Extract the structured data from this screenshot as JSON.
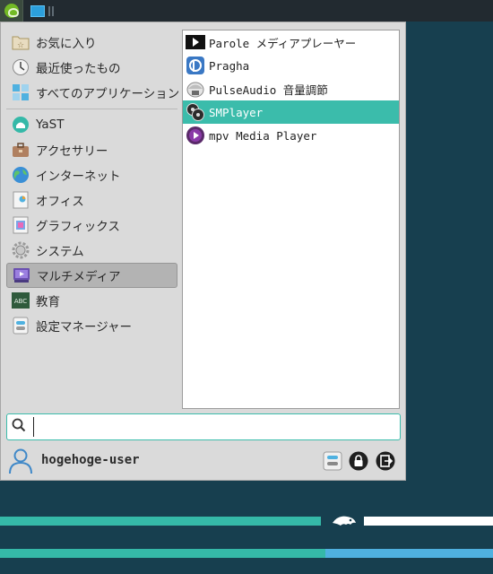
{
  "categories": [
    {
      "label": "お気に入り",
      "icon": "favorites-folder-icon"
    },
    {
      "label": "最近使ったもの",
      "icon": "recent-clock-icon"
    },
    {
      "label": "すべてのアプリケーション",
      "icon": "all-apps-grid-icon"
    },
    {
      "label": "YaST",
      "icon": "yast-icon"
    },
    {
      "label": "アクセサリー",
      "icon": "accessories-briefcase-icon"
    },
    {
      "label": "インターネット",
      "icon": "internet-globe-icon"
    },
    {
      "label": "オフィス",
      "icon": "office-icon"
    },
    {
      "label": "グラフィックス",
      "icon": "graphics-icon"
    },
    {
      "label": "システム",
      "icon": "system-gear-icon"
    },
    {
      "label": "マルチメディア",
      "icon": "multimedia-icon"
    },
    {
      "label": "教育",
      "icon": "education-abc-icon"
    },
    {
      "label": "設定マネージャー",
      "icon": "settings-manager-icon"
    }
  ],
  "selected_category": "マルチメディア",
  "apps": [
    {
      "label": "Parole メディアプレーヤー",
      "icon": "parole-play-icon"
    },
    {
      "label": "Pragha",
      "icon": "pragha-icon"
    },
    {
      "label": "PulseAudio 音量調節",
      "icon": "pulseaudio-icon"
    },
    {
      "label": "SMPlayer",
      "icon": "smplayer-icon"
    },
    {
      "label": "mpv Media Player",
      "icon": "mpv-icon"
    }
  ],
  "selected_app": "SMPlayer",
  "search": {
    "value": "",
    "placeholder": ""
  },
  "user": {
    "name": "hogehoge-user"
  },
  "colors": {
    "accent": "#3bbcab",
    "panel": "#222a30",
    "desktop": "#173f4f",
    "menu_bg": "#dadada"
  }
}
